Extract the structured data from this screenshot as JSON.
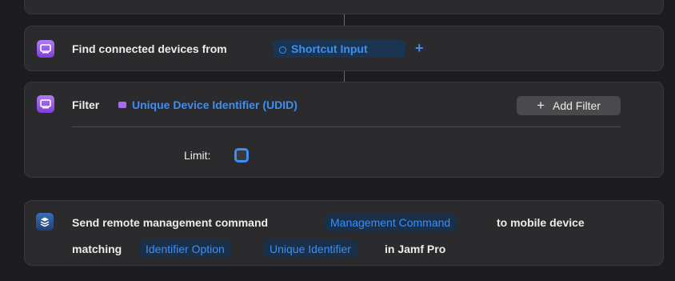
{
  "find_action": {
    "prefix": "Find connected devices from",
    "input_token_icon": "gear-circle-icon",
    "input_token": "Shortcut Input",
    "add_symbol": "+"
  },
  "filter_action": {
    "label": "Filter",
    "property_token": "Unique Device Identifier (UDID)",
    "add_filter_symbol": "+",
    "add_filter_label": "Add Filter",
    "limit_label": "Limit:"
  },
  "send_action": {
    "prefix": "Send remote management command",
    "command_token": "Management Command",
    "middle": "to mobile device",
    "matching_label": "matching",
    "identifier_option_token": "Identifier Option",
    "unique_identifier_token": "Unique Identifier",
    "suffix": "in Jamf Pro"
  },
  "colors": {
    "accent": "#3d8ef5",
    "card_bg": "#2b2b2d",
    "icon_purple": "#9a5fe8",
    "icon_blue": "#2b5a9e"
  }
}
